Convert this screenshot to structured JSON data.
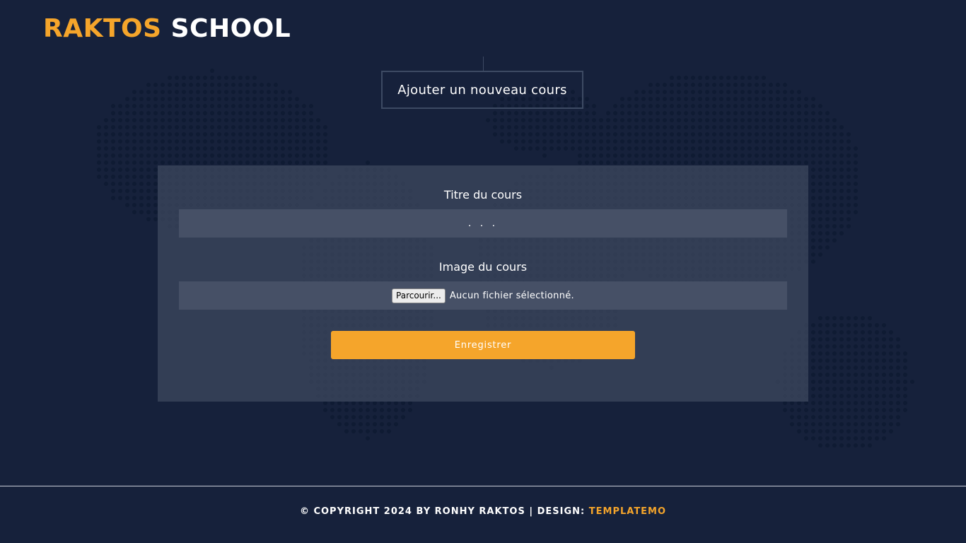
{
  "brand": {
    "part1": "RAKTOS",
    "part2": "SCHOOL"
  },
  "page_title": "Ajouter un nouveau cours",
  "form": {
    "title_label": "Titre du cours",
    "title_placeholder": ". . .",
    "title_value": "",
    "image_label": "Image du cours",
    "browse_label": "Parcourir...",
    "file_status": "Aucun fichier sélectionné.",
    "submit_label": "Enregistrer"
  },
  "footer": {
    "copyright": "© COPYRIGHT 2024 BY RONHY RAKTOS | DESIGN: ",
    "design_link": "TEMPLATEMO"
  },
  "colors": {
    "background": "#16213b",
    "accent": "#f5a52b",
    "card": "#3f4a60",
    "field": "#465066"
  },
  "icons": {
    "background": "world-map-dots"
  }
}
